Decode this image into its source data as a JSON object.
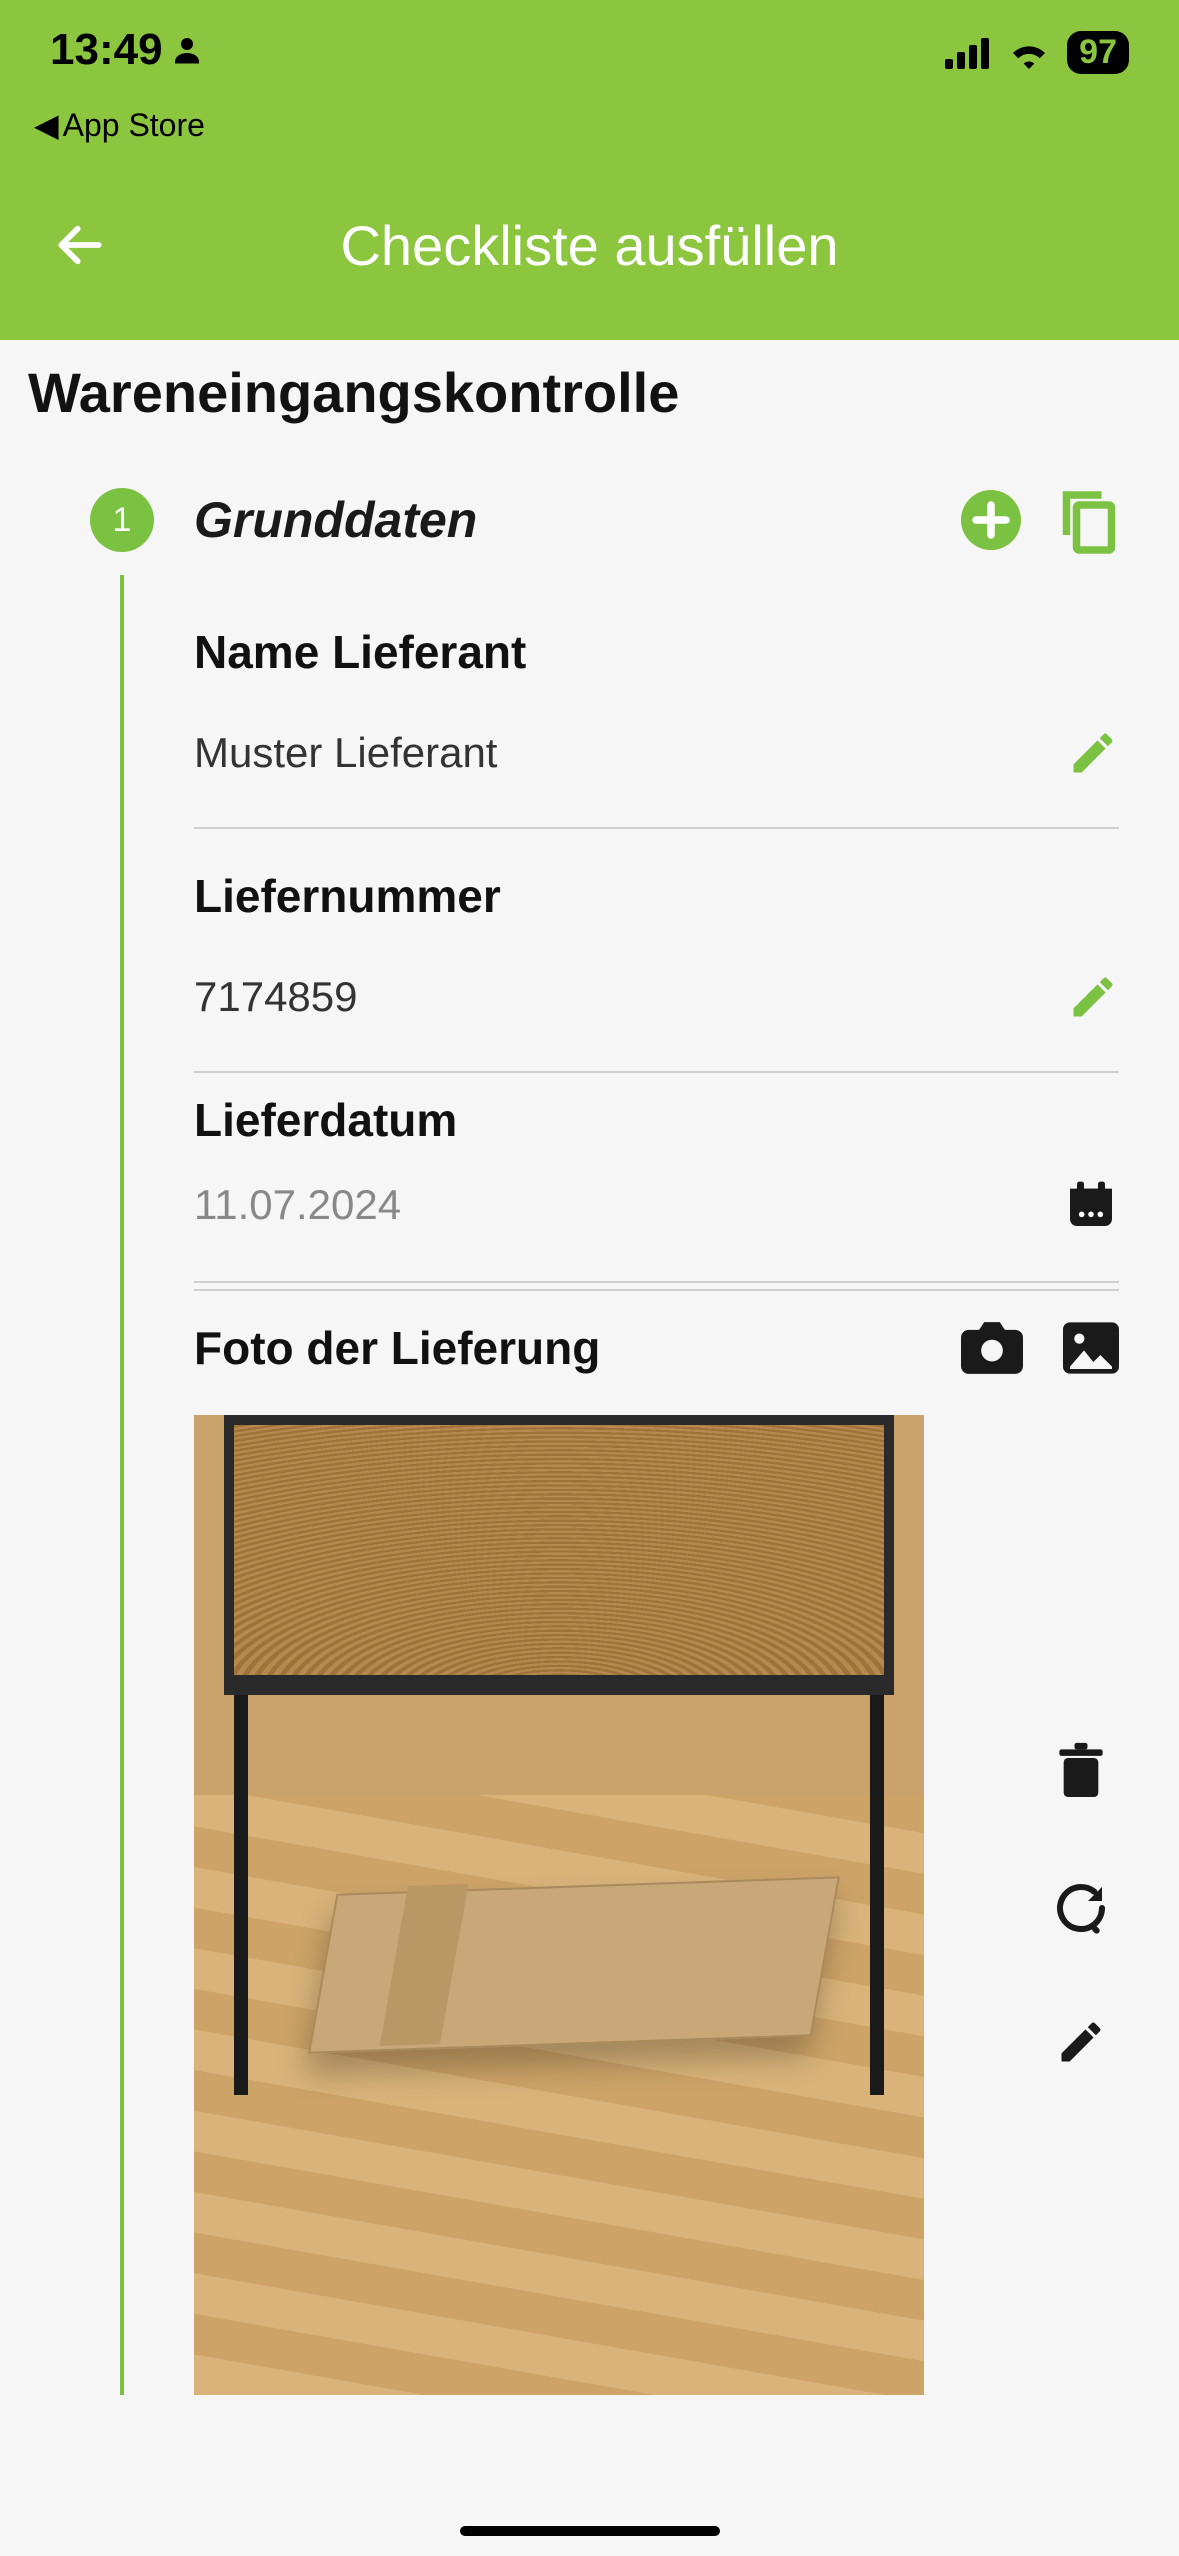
{
  "status": {
    "time": "13:49",
    "back_link": "App Store",
    "battery": "97"
  },
  "header": {
    "title": "Checkliste ausfüllen"
  },
  "page": {
    "subtitle": "Wareneingangskontrolle"
  },
  "section": {
    "step_number": "1",
    "title": "Grunddaten"
  },
  "fields": {
    "supplier": {
      "label": "Name Lieferant",
      "value": "Muster Lieferant"
    },
    "delivery_number": {
      "label": "Liefernummer",
      "value": "7174859"
    },
    "delivery_date": {
      "label": "Lieferdatum",
      "value": "11.07.2024"
    },
    "photo": {
      "label": "Foto der Lieferung"
    }
  },
  "colors": {
    "accent": "#8cc63f",
    "accent_alt": "#7bc142"
  }
}
